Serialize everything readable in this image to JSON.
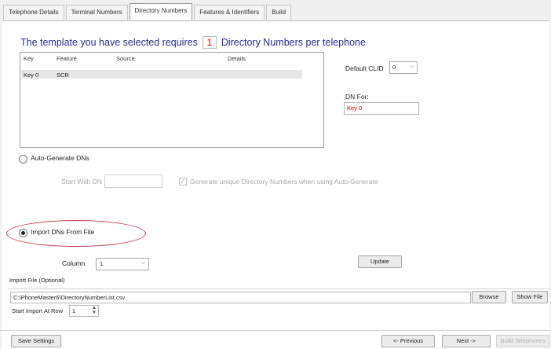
{
  "tabs": [
    "Telephone Details",
    "Terminal Numbers",
    "Directory Numbers",
    "Features & Identifiers",
    "Build"
  ],
  "heading": {
    "prefix": "The template you have selected requires",
    "count": "1",
    "suffix": "Directory Numbers per telephone"
  },
  "list": {
    "columns": [
      "Key",
      "Feature",
      "Source",
      "Details"
    ],
    "rows": [
      {
        "key": "Key 0",
        "feature": "SCR",
        "source": "",
        "details": ""
      }
    ]
  },
  "default_clid": {
    "label": "Default CLID",
    "value": "0"
  },
  "dn_for": {
    "label": "DN For:",
    "value": "Key 0"
  },
  "auto_generate": {
    "label": "Auto-Generate DNs",
    "start_label": "Start With DN",
    "start_value": "",
    "unique_checkbox_label": "Generate unique Directory Numbers when using Auto-Generate"
  },
  "import": {
    "label": "Import DNs From File",
    "column_label": "Column",
    "column_value": "1",
    "update_button": "Update",
    "file_label": "Import File (Optional)",
    "file_path": "C:\\PhoneMaster6\\DirectoryNumberList.csv",
    "browse_button": "Browse",
    "show_file_button": "Show File",
    "start_row_label": "Start Import At Row",
    "start_row_value": "1"
  },
  "footer": {
    "save": "Save Settings",
    "previous": "<- Previous",
    "next": "Next ->",
    "build": "Build Telephones"
  },
  "colors": {
    "heading": "#2a2a9c",
    "accent_red": "#d40000",
    "oval": "#c9414c"
  }
}
